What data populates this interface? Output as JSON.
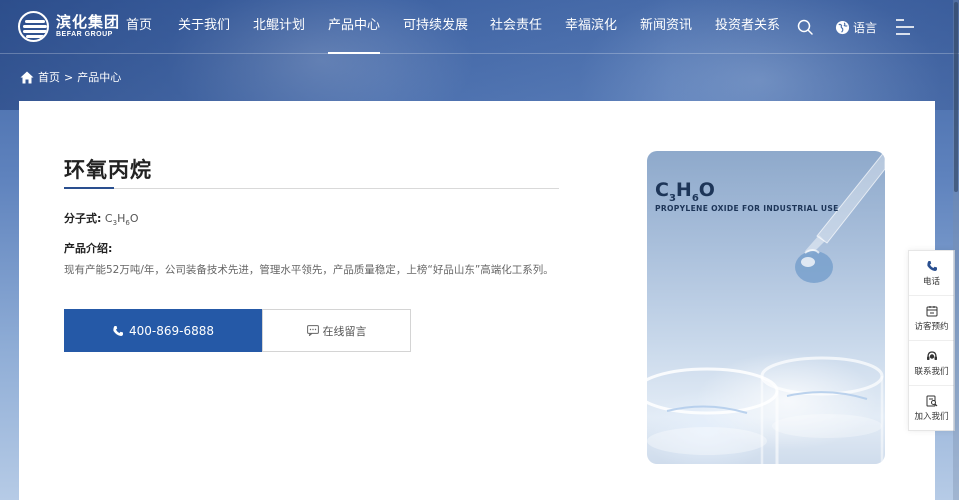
{
  "brand": {
    "name_cn": "滨化集团",
    "name_en": "BEFAR GROUP"
  },
  "nav": {
    "items": [
      {
        "label": "首页",
        "active": false
      },
      {
        "label": "关于我们",
        "active": false
      },
      {
        "label": "北鲲计划",
        "active": false
      },
      {
        "label": "产品中心",
        "active": true
      },
      {
        "label": "可持续发展",
        "active": false
      },
      {
        "label": "社会责任",
        "active": false
      },
      {
        "label": "幸福滨化",
        "active": false
      },
      {
        "label": "新闻资讯",
        "active": false
      },
      {
        "label": "投资者关系",
        "active": false
      }
    ],
    "language_label": "语言"
  },
  "breadcrumb": {
    "home": "首页",
    "separator": ">",
    "current": "产品中心"
  },
  "product": {
    "title": "环氧丙烷",
    "formula_label": "分子式:",
    "formula_parts": [
      "C",
      "3",
      "H",
      "6",
      "O"
    ],
    "intro_label": "产品介绍:",
    "intro_text": "现有产能52万吨/年，公司装备技术先进，管理水平领先，产品质量稳定，上榜“好品山东”高端化工系列。",
    "phone_button": "400-869-6888",
    "message_button": "在线留言"
  },
  "product_image": {
    "formula_parts": [
      "C",
      "3",
      "H",
      "6",
      "O"
    ],
    "caption": "PROPYLENE OXIDE FOR INDUSTRIAL USE"
  },
  "float_bar": {
    "items": [
      {
        "label": "电话",
        "icon": "phone-icon"
      },
      {
        "label": "访客预约",
        "icon": "calendar-icon"
      },
      {
        "label": "联系我们",
        "icon": "headset-icon"
      },
      {
        "label": "加入我们",
        "icon": "search-doc-icon"
      }
    ]
  },
  "colors": {
    "primary": "#2559a7",
    "title_accent": "#2a4f8f",
    "header_text": "#ffffff"
  }
}
